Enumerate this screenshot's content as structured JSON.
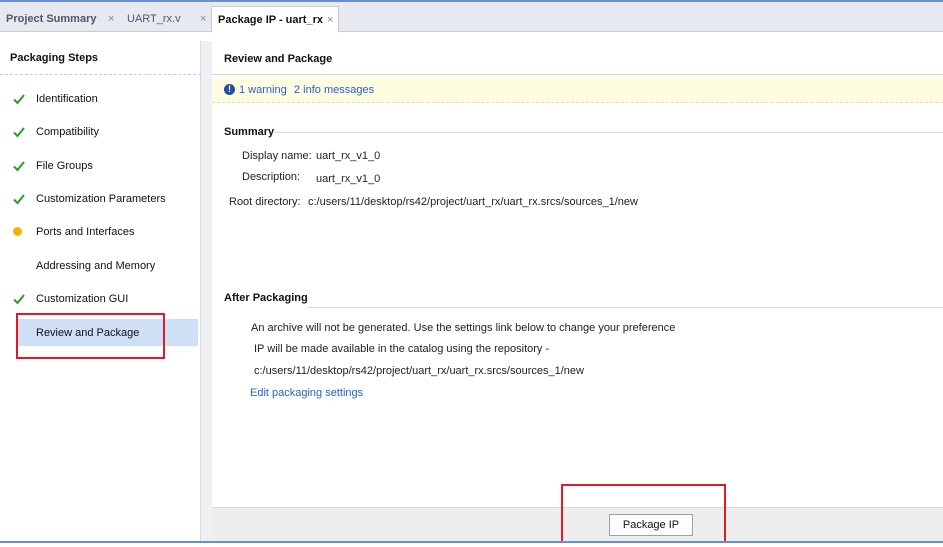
{
  "tabs": [
    {
      "label": "Project Summary",
      "close": "×"
    },
    {
      "label": "UART_rx.v",
      "close": "×"
    },
    {
      "label": "Package IP - uart_rx",
      "close": "×"
    }
  ],
  "left": {
    "title": "Packaging Steps",
    "steps": [
      {
        "label": "Identification",
        "status": "check"
      },
      {
        "label": "Compatibility",
        "status": "check"
      },
      {
        "label": "File Groups",
        "status": "check"
      },
      {
        "label": "Customization Parameters",
        "status": "check"
      },
      {
        "label": "Ports and Interfaces",
        "status": "warning"
      },
      {
        "label": "Addressing and Memory",
        "status": "none"
      },
      {
        "label": "Customization GUI",
        "status": "check"
      },
      {
        "label": "Review and Package",
        "status": "none"
      }
    ]
  },
  "right": {
    "title": "Review and Package",
    "messages": {
      "warning_link": "1 warning",
      "info_link": "2 info messages"
    },
    "summary": {
      "title": "Summary",
      "display_name_label": "Display name:",
      "display_name": "uart_rx_v1_0",
      "description_label": "Description:",
      "description": "uart_rx_v1_0",
      "root_dir_label": "Root directory:",
      "root_dir": "c:/users/11/desktop/rs42/project/uart_rx/uart_rx.srcs/sources_1/new"
    },
    "after": {
      "title": "After Packaging",
      "line1": "An archive will not be generated. Use the settings link below to change your preference",
      "line2": "IP will be made available in the catalog using the repository -",
      "line3": "c:/users/11/desktop/rs42/project/uart_rx/uart_rx.srcs/sources_1/new",
      "edit_link": "Edit packaging settings"
    },
    "package_button": "Package IP"
  },
  "colors": {
    "accent": "#2a61c9",
    "check": "#2e9a2e",
    "warning": "#f2b400",
    "highlight": "#e01b24",
    "selected": "#cfe0f6"
  }
}
